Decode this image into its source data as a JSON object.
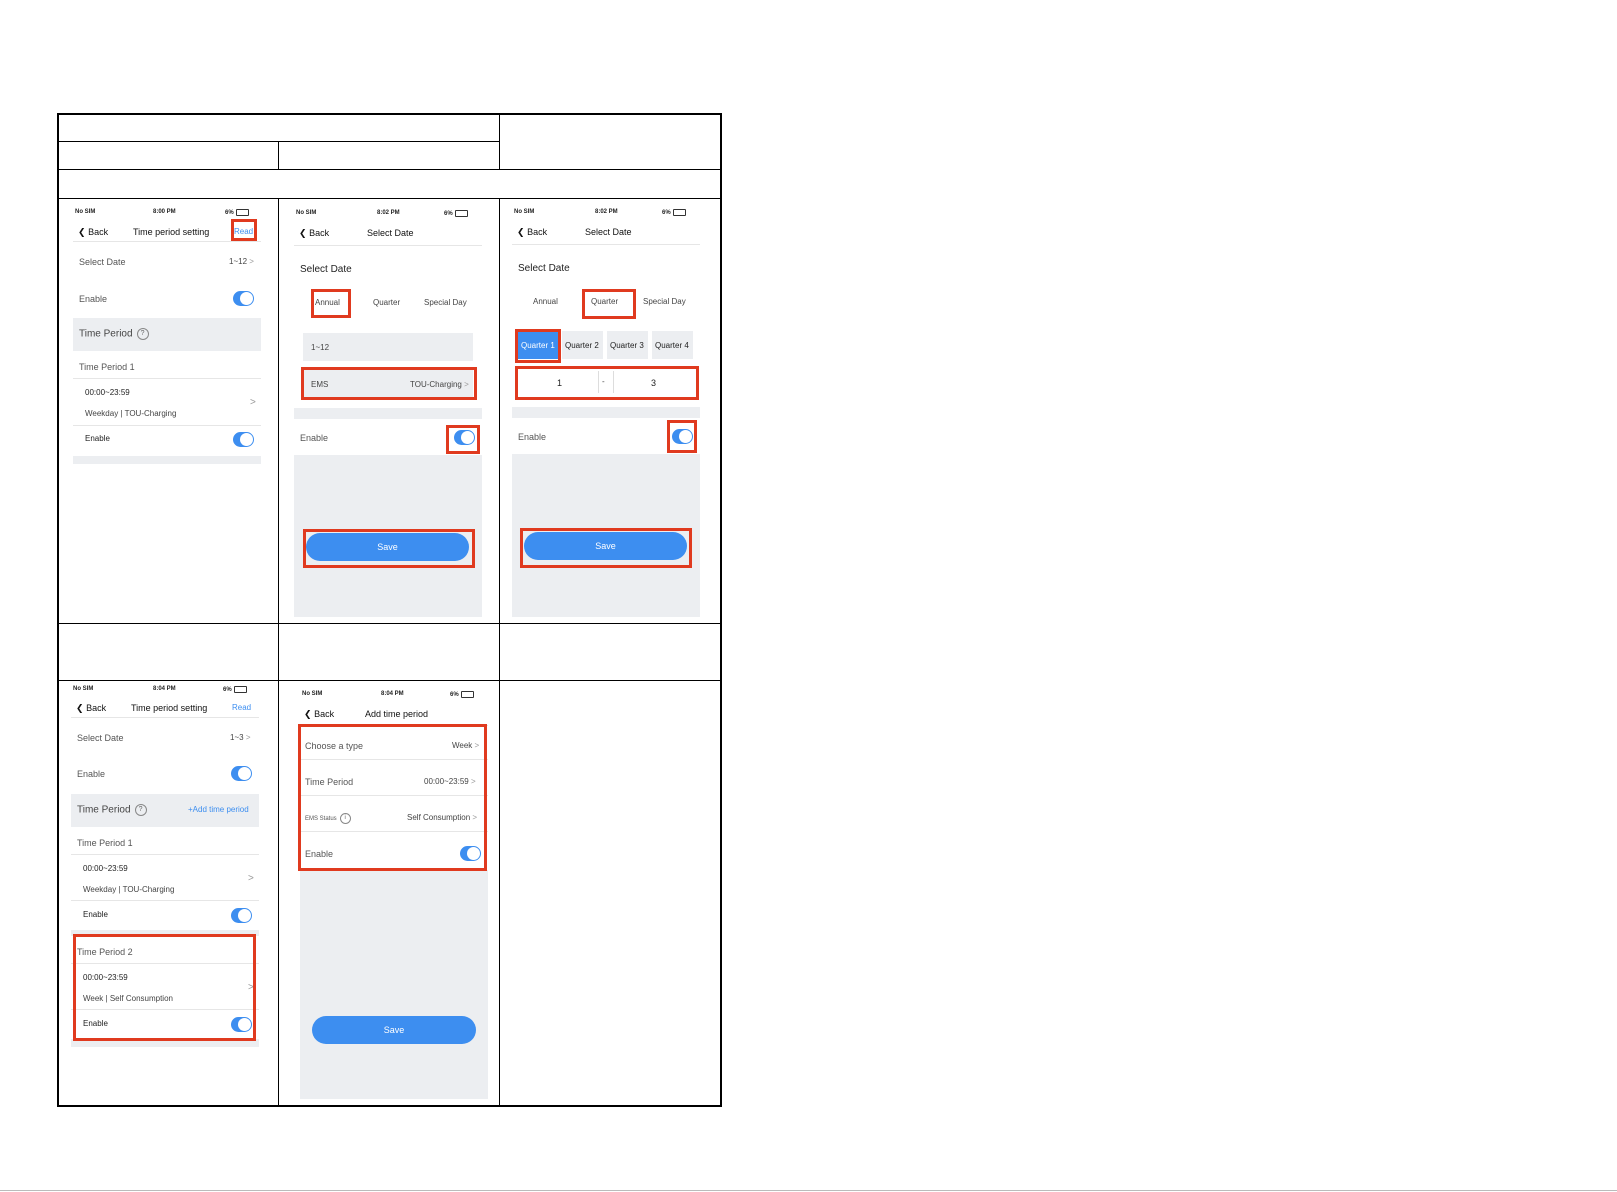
{
  "status": {
    "carrier": "No SIM",
    "battery": "6%",
    "times": [
      "8:00 PM",
      "8:02 PM",
      "8:02 PM",
      "8:04 PM",
      "8:04 PM"
    ]
  },
  "common": {
    "back": "Back",
    "read": "Read",
    "enable": "Enable",
    "save": "Save",
    "chevron": ">"
  },
  "screen1": {
    "title": "Time period setting",
    "select_date_label": "Select Date",
    "select_date_value": "1~12",
    "time_period_header": "Time Period",
    "period1_name": "Time Period 1",
    "period1_time": "00:00~23:59",
    "period1_detail": "Weekday | TOU-Charging"
  },
  "screen2": {
    "title": "Select Date",
    "heading": "Select Date",
    "tabs": [
      "Annual",
      "Quarter",
      "Special Day"
    ],
    "range_value": "1~12",
    "ems_label": "EMS",
    "ems_value": "TOU-Charging"
  },
  "screen3": {
    "title": "Select Date",
    "heading": "Select Date",
    "tabs": [
      "Annual",
      "Quarter",
      "Special Day"
    ],
    "quarters": [
      "Quarter 1",
      "Quarter 2",
      "Quarter 3",
      "Quarter 4"
    ],
    "month_from": "1",
    "month_sep": "-",
    "month_to": "3"
  },
  "screen4": {
    "title": "Time period setting",
    "select_date_label": "Select Date",
    "select_date_value": "1~3",
    "time_period_header": "Time Period",
    "add_time_period": "+Add time period",
    "period1_name": "Time Period 1",
    "period1_time": "00:00~23:59",
    "period1_detail": "Weekday | TOU-Charging",
    "period2_name": "Time Period 2",
    "period2_time": "00:00~23:59",
    "period2_detail": "Week | Self Consumption"
  },
  "screen5": {
    "title": "Add time period",
    "type_label": "Choose a type",
    "type_value": "Week",
    "time_label": "Time Period",
    "time_value": "00:00~23:59",
    "ems_label": "EMS Status",
    "ems_value": "Self Consumption"
  }
}
